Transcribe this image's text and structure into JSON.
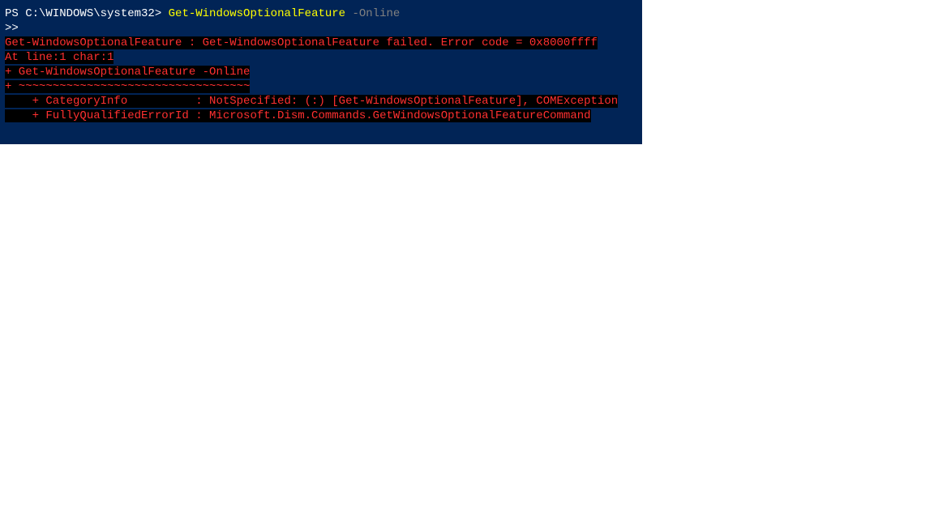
{
  "console": {
    "prompt": {
      "path": "PS C:\\WINDOWS\\system32> ",
      "command": "Get-WindowsOptionalFeature",
      "arg": " -Online"
    },
    "continuation": ">>",
    "error": {
      "line1": "Get-WindowsOptionalFeature : Get-WindowsOptionalFeature failed. Error code = 0x8000ffff",
      "line2": "At line:1 char:1",
      "line3": "+ Get-WindowsOptionalFeature -Online",
      "line4": "+ ~~~~~~~~~~~~~~~~~~~~~~~~~~~~~~~~~~",
      "line5": "    + CategoryInfo          : NotSpecified: (:) [Get-WindowsOptionalFeature], COMException",
      "line6": "    + FullyQualifiedErrorId : Microsoft.Dism.Commands.GetWindowsOptionalFeatureCommand"
    }
  }
}
